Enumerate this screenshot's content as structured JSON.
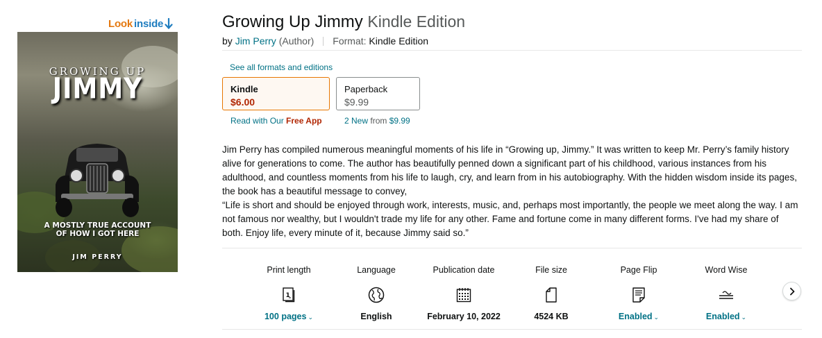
{
  "look_inside": {
    "look": "Look",
    "inside": "inside"
  },
  "cover": {
    "title_small": "GROWING UP",
    "title_big": "JIMMY",
    "subtitle_line1": "A MOSTLY TRUE ACCOUNT",
    "subtitle_line2": "OF HOW I GOT HERE",
    "author": "JIM PERRY"
  },
  "product": {
    "title": "Growing Up Jimmy",
    "edition": "Kindle Edition",
    "by": "by",
    "author_name": "Jim Perry",
    "author_role": "(Author)",
    "format_label": "Format:",
    "format_value": "Kindle Edition"
  },
  "formats": {
    "see_all": "See all formats and editions",
    "kindle": {
      "name": "Kindle",
      "price": "$6.00"
    },
    "paperback": {
      "name": "Paperback",
      "price": "$9.99"
    },
    "kindle_sub": {
      "prefix": "Read with Our",
      "highlight": "Free App"
    },
    "paperback_sub": {
      "new_count": "2 New",
      "from": "from",
      "price": "$9.99"
    }
  },
  "description": {
    "p1": "Jim Perry has compiled numerous meaningful moments of his life in “Growing up, Jimmy.” It was written to keep Mr. Perry’s family history alive for generations to come. The author has beautifully penned down a significant part of his childhood, various instances from his adulthood, and countless moments from his life to laugh, cry, and learn from in his autobiography. With the hidden wisdom inside its pages, the book has a beautiful message to convey,",
    "p2": "“Life is short and should be enjoyed through work, interests, music, and, perhaps most importantly, the people we meet along the way. I am not famous nor wealthy, but I wouldn't trade my life for any other. Fame and fortune come in many different forms. I've had my share of both. Enjoy life, every minute of it, because Jimmy said so.”"
  },
  "attributes": [
    {
      "label": "Print length",
      "value": "100 pages",
      "icon": "book-pages-icon"
    },
    {
      "label": "Language",
      "value": "English",
      "icon": "globe-icon"
    },
    {
      "label": "Publication date",
      "value": "February 10, 2022",
      "icon": "calendar-icon"
    },
    {
      "label": "File size",
      "value": "4524 KB",
      "icon": "file-icon"
    },
    {
      "label": "Page Flip",
      "value": "Enabled",
      "icon": "page-flip-icon"
    },
    {
      "label": "Word Wise",
      "value": "Enabled",
      "icon": "word-wise-icon"
    }
  ],
  "colors": {
    "link": "#007185",
    "price_red": "#b12704",
    "selected_border": "#e77600",
    "look_inside_orange": "#e47911"
  }
}
